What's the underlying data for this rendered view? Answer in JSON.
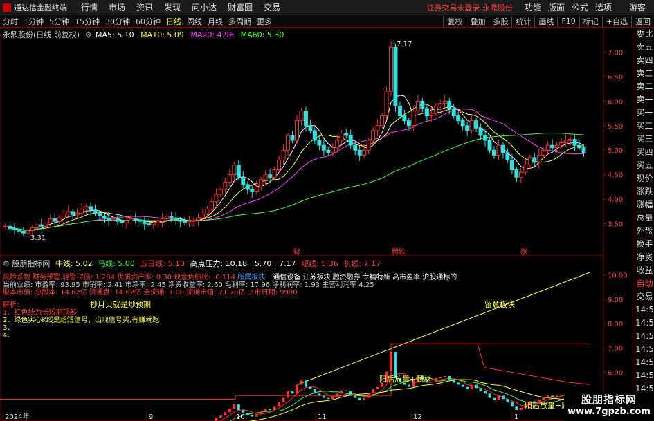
{
  "topbar": {
    "app_name": "通达信金融终端",
    "menus": [
      "行情",
      "市场",
      "资讯",
      "发现",
      "问小达",
      "财富圈",
      "交易"
    ],
    "notice": "证券交易未登录  永鼎股份",
    "right_menus": [
      "功能",
      "版面",
      "公式",
      "选项"
    ],
    "guest": "游客"
  },
  "periodbar": {
    "periods": [
      "分时",
      "1分钟",
      "5分钟",
      "15分钟",
      "30分钟",
      "60分钟",
      "日线",
      "周线",
      "月线",
      "多周期",
      "更多"
    ],
    "active": "日线",
    "tools": [
      "复权",
      "叠加",
      "多股",
      "统计",
      "画线",
      "F10",
      "标记",
      "+自选",
      "返回"
    ]
  },
  "main_chart": {
    "title": "永鼎股份(日线 前复权)",
    "ma": [
      {
        "label": "MA5: 5.10",
        "color": "#ffffff"
      },
      {
        "label": "MA10: 5.09",
        "color": "#ffff40"
      },
      {
        "label": "MA20: 4.96",
        "color": "#ff40ff"
      },
      {
        "label": "MA60: 5.30",
        "color": "#40ff40"
      }
    ],
    "high_label": "7.17",
    "low_label": "3.31",
    "markers": [
      {
        "text": "财",
        "x": 430
      },
      {
        "text": "腾跌",
        "x": 572
      },
      {
        "text": "涨",
        "x": 758
      }
    ],
    "y_ticks": [
      "7.00",
      "6.50",
      "6.00",
      "5.50",
      "5.00",
      "4.50",
      "4.00",
      "3.50"
    ]
  },
  "indicator": {
    "name": "股朋指标网",
    "values": [
      {
        "label": "牛线: 5.02",
        "color": "#ffff40"
      },
      {
        "label": "马线: 5.00",
        "color": "#40ff40"
      },
      {
        "label": "五日线: 5.10",
        "color": "#ff4040"
      },
      {
        "label": "高点压力: 10.18 : 5.70 : 7.17",
        "color": "#ffffff"
      },
      {
        "label": "短线: 5.36",
        "color": "#ff4040"
      },
      {
        "label": "长线: 7.17",
        "color": "#ff4040"
      }
    ],
    "info1": "风险系数 财务预警 轻警-Z值: 1.284 优质资产率: 0.30 现金负债比: -0.114",
    "info1_b": "所属板块",
    "info1_c": "通信设备    江苏板块    融资融券 专精特新 高市盈率 沪股通标的",
    "info2": "当前业绩: 市盈率: 93.95 市销率: 2.41 市净率: 2.45 净资收益率: 2.60 毛利率: 17.96 净利润率: 1.93 主营利润率 4.25",
    "info3": "股本市值: 总股本: 14.62亿 流通盘: 14.62亿 全流通: 1.00 流通市值: 71.78亿 上市日期: 9990",
    "analysis_title": "解析:",
    "analysis1": "1、红色线为长短期顶部",
    "analysis2": "2、绿色实心K线是超短信号，出现信号买,有赚就跑",
    "analysis3": "3、",
    "analysis4": "4、",
    "slogan": "抄月贝就是炒预期",
    "note1": "留意板块",
    "note2": "阳后放量+题材",
    "note3": "阳后放量+题材",
    "y_ticks": [
      "10.00",
      "9.00",
      "8.00",
      "7.00",
      "6.00",
      "5.00"
    ]
  },
  "date_axis": {
    "labels": [
      "2024年",
      "9",
      "10",
      "11",
      "12",
      "1"
    ]
  },
  "right_panel": {
    "items": [
      "委比",
      "卖五",
      "卖四",
      "卖三",
      "卖二",
      "卖一",
      "买一",
      "买二",
      "买三",
      "买四",
      "买五",
      "现价",
      "涨跌",
      "涨幅",
      "总量",
      "外盘",
      "换手",
      "净资",
      "收益",
      "自动",
      "交易",
      "14:5",
      "14:5",
      "14:5",
      "14:5",
      "14:5",
      "14:5",
      "14:5",
      "14:5"
    ],
    "highlight": [
      "自动"
    ]
  },
  "watermark": {
    "line1": "股朋指标网",
    "line2": "www.7gpzb.com"
  },
  "chart_data": {
    "type": "candlestick",
    "title": "永鼎股份(日线 前复权)",
    "y_range": [
      3.2,
      7.3
    ],
    "closes": [
      3.45,
      3.4,
      3.38,
      3.35,
      3.31,
      3.36,
      3.42,
      3.48,
      3.45,
      3.52,
      3.6,
      3.55,
      3.62,
      3.7,
      3.75,
      3.68,
      3.72,
      3.8,
      3.85,
      3.78,
      3.72,
      3.66,
      3.62,
      3.58,
      3.6,
      3.55,
      3.52,
      3.56,
      3.6,
      3.58,
      3.55,
      3.5,
      3.48,
      3.52,
      3.55,
      3.6,
      3.65,
      3.62,
      3.58,
      3.55,
      3.52,
      3.55,
      3.58,
      3.62,
      3.7,
      3.8,
      3.95,
      4.1,
      4.2,
      4.35,
      4.5,
      4.7,
      4.45,
      4.3,
      4.2,
      4.15,
      4.25,
      4.4,
      4.5,
      4.45,
      4.6,
      4.8,
      5.0,
      5.3,
      5.2,
      5.6,
      5.8,
      5.5,
      5.4,
      5.2,
      5.1,
      5.0,
      4.95,
      5.05,
      5.2,
      5.35,
      5.3,
      5.1,
      5.0,
      4.9,
      5.0,
      5.2,
      5.4,
      5.5,
      5.7,
      6.2,
      7.1,
      5.9,
      5.7,
      5.6,
      5.5,
      5.8,
      6.0,
      5.85,
      5.7,
      5.75,
      5.9,
      5.95,
      6.0,
      5.85,
      5.7,
      5.6,
      5.5,
      5.4,
      5.6,
      5.45,
      5.3,
      5.2,
      5.0,
      4.9,
      5.1,
      4.95,
      4.8,
      4.6,
      4.45,
      4.55,
      4.7,
      4.85,
      4.75,
      4.9,
      5.0,
      5.1,
      5.05,
      5.1,
      5.15,
      5.2,
      5.22,
      5.1,
      5.05,
      4.95
    ]
  }
}
